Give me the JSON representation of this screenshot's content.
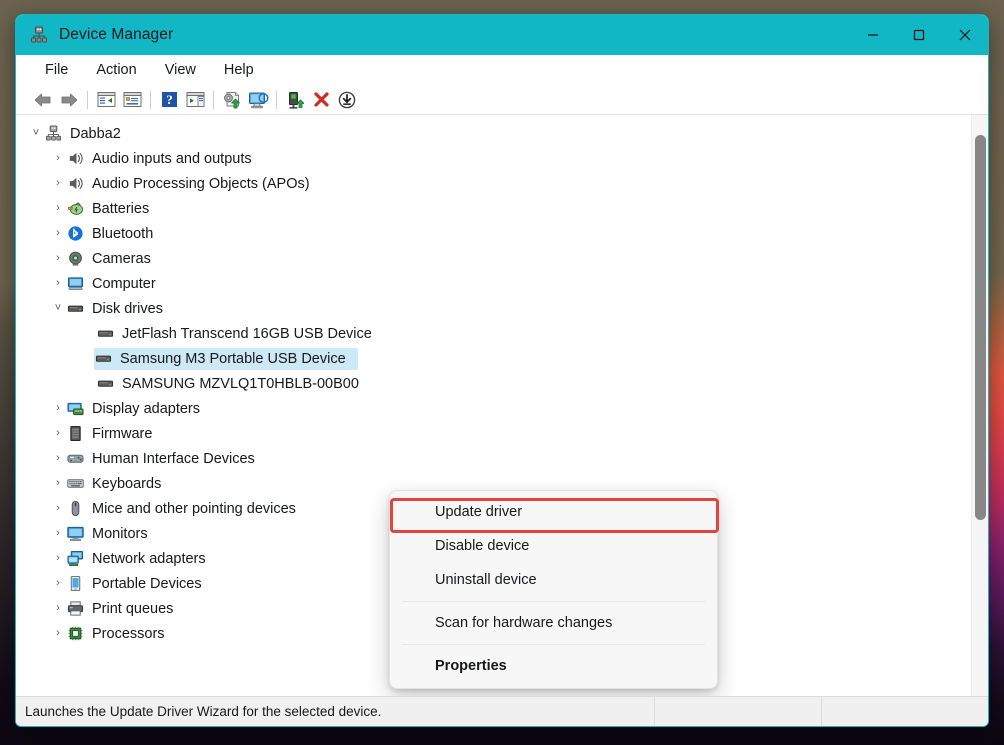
{
  "window": {
    "title": "Device Manager",
    "title_icon": "device-manager-icon",
    "controls": {
      "minimize": "minimize-icon",
      "maximize": "maximize-icon",
      "close": "close-icon"
    },
    "accent_color": "#12b7c6"
  },
  "menubar": {
    "items": [
      {
        "label": "File"
      },
      {
        "label": "Action"
      },
      {
        "label": "View"
      },
      {
        "label": "Help"
      }
    ]
  },
  "toolbar": {
    "buttons": [
      {
        "name": "back-icon",
        "tip": "Back"
      },
      {
        "name": "forward-icon",
        "tip": "Forward"
      },
      {
        "name": "show-hide-console-tree-icon",
        "tip": "Show/hide console tree"
      },
      {
        "name": "properties-icon",
        "tip": "Properties"
      },
      {
        "name": "help-icon",
        "tip": "Help"
      },
      {
        "name": "show-hide-action-pane-icon",
        "tip": "Show/hide action pane"
      },
      {
        "name": "update-driver-icon",
        "tip": "Update driver"
      },
      {
        "name": "scan-for-hardware-changes-icon",
        "tip": "Scan for hardware changes"
      },
      {
        "name": "enable-device-icon",
        "tip": "Enable device"
      },
      {
        "name": "uninstall-device-icon",
        "tip": "Uninstall device"
      },
      {
        "name": "download-icon",
        "tip": "Download"
      }
    ]
  },
  "tree": {
    "root": {
      "label": "Dabba2",
      "icon": "computer-root-icon",
      "expanded": true
    },
    "nodes": [
      {
        "label": "Audio inputs and outputs",
        "icon": "speaker-icon",
        "depth": 1,
        "expanded": false,
        "selected": false
      },
      {
        "label": "Audio Processing Objects (APOs)",
        "icon": "speaker-icon",
        "depth": 1,
        "expanded": false,
        "selected": false
      },
      {
        "label": "Batteries",
        "icon": "battery-icon",
        "depth": 1,
        "expanded": false,
        "selected": false
      },
      {
        "label": "Bluetooth",
        "icon": "bluetooth-icon",
        "depth": 1,
        "expanded": false,
        "selected": false
      },
      {
        "label": "Cameras",
        "icon": "camera-icon",
        "depth": 1,
        "expanded": false,
        "selected": false
      },
      {
        "label": "Computer",
        "icon": "computer-icon",
        "depth": 1,
        "expanded": false,
        "selected": false
      },
      {
        "label": "Disk drives",
        "icon": "disk-drive-icon",
        "depth": 1,
        "expanded": true,
        "selected": false
      },
      {
        "label": "JetFlash Transcend 16GB USB Device",
        "icon": "disk-drive-icon",
        "depth": 2,
        "expanded": null,
        "selected": false
      },
      {
        "label": "Samsung M3 Portable USB Device",
        "icon": "disk-drive-icon",
        "depth": 2,
        "expanded": null,
        "selected": true
      },
      {
        "label": "SAMSUNG MZVLQ1T0HBLB-00B00",
        "icon": "disk-drive-icon",
        "depth": 2,
        "expanded": null,
        "selected": false
      },
      {
        "label": "Display adapters",
        "icon": "display-adapter-icon",
        "depth": 1,
        "expanded": false,
        "selected": false
      },
      {
        "label": "Firmware",
        "icon": "firmware-icon",
        "depth": 1,
        "expanded": false,
        "selected": false
      },
      {
        "label": "Human Interface Devices",
        "icon": "hid-icon",
        "depth": 1,
        "expanded": false,
        "selected": false
      },
      {
        "label": "Keyboards",
        "icon": "keyboard-icon",
        "depth": 1,
        "expanded": false,
        "selected": false
      },
      {
        "label": "Mice and other pointing devices",
        "icon": "mouse-icon",
        "depth": 1,
        "expanded": false,
        "selected": false
      },
      {
        "label": "Monitors",
        "icon": "monitor-icon",
        "depth": 1,
        "expanded": false,
        "selected": false
      },
      {
        "label": "Network adapters",
        "icon": "network-adapter-icon",
        "depth": 1,
        "expanded": false,
        "selected": false
      },
      {
        "label": "Portable Devices",
        "icon": "portable-device-icon",
        "depth": 1,
        "expanded": false,
        "selected": false
      },
      {
        "label": "Print queues",
        "icon": "printer-icon",
        "depth": 1,
        "expanded": false,
        "selected": false
      },
      {
        "label": "Processors",
        "icon": "processor-icon",
        "depth": 1,
        "expanded": false,
        "selected": false
      }
    ]
  },
  "context_menu": {
    "items": [
      {
        "label": "Update driver",
        "bold": false,
        "highlighted": true
      },
      {
        "label": "Disable device",
        "bold": false,
        "highlighted": false
      },
      {
        "label": "Uninstall device",
        "bold": false,
        "highlighted": false
      },
      {
        "separator": true
      },
      {
        "label": "Scan for hardware changes",
        "bold": false,
        "highlighted": false
      },
      {
        "separator": true
      },
      {
        "label": "Properties",
        "bold": true,
        "highlighted": false
      }
    ],
    "highlight_color": "#e1453c"
  },
  "statusbar": {
    "text": "Launches the Update Driver Wizard for the selected device."
  }
}
